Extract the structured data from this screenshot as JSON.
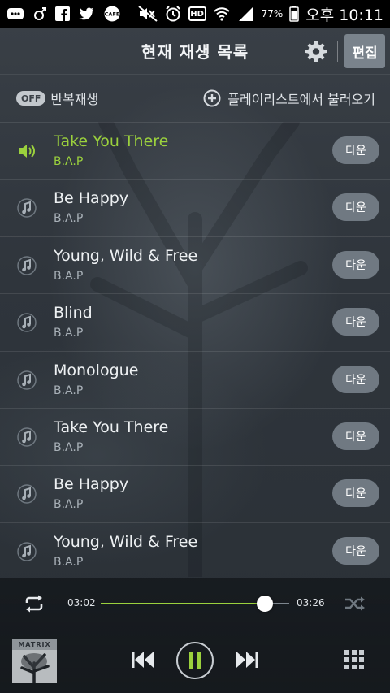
{
  "status_bar": {
    "battery": "77%",
    "time": "오후 10:11",
    "icons": [
      "chat-icon",
      "male-icon",
      "facebook-icon",
      "twitter-icon",
      "cafe-icon",
      "mute-icon",
      "alarm-icon",
      "hd-icon",
      "wifi-icon",
      "signal-icon",
      "battery-icon"
    ],
    "hd_label": "HD",
    "cafe_label": "CAFE"
  },
  "header": {
    "title": "현재 재생 목록",
    "edit_label": "편집"
  },
  "options": {
    "repeat_toggle": "OFF",
    "repeat_label": "반복재생",
    "load_playlist_label": "플레이리스트에서 불러오기"
  },
  "playlist": {
    "download_label": "다운",
    "items": [
      {
        "title": "Take You There",
        "artist": "B.A.P",
        "active": true
      },
      {
        "title": "Be Happy",
        "artist": "B.A.P",
        "active": false
      },
      {
        "title": "Young, Wild & Free",
        "artist": "B.A.P",
        "active": false
      },
      {
        "title": "Blind",
        "artist": "B.A.P",
        "active": false
      },
      {
        "title": "Monologue",
        "artist": "B.A.P",
        "active": false
      },
      {
        "title": "Take You There",
        "artist": "B.A.P",
        "active": false
      },
      {
        "title": "Be Happy",
        "artist": "B.A.P",
        "active": false
      },
      {
        "title": "Young, Wild & Free",
        "artist": "B.A.P",
        "active": false
      }
    ]
  },
  "player": {
    "current_time": "03:02",
    "total_time": "03:26",
    "progress": 0.87,
    "album_text": "MATRIX",
    "colors": {
      "accent": "#9bd13d"
    }
  }
}
